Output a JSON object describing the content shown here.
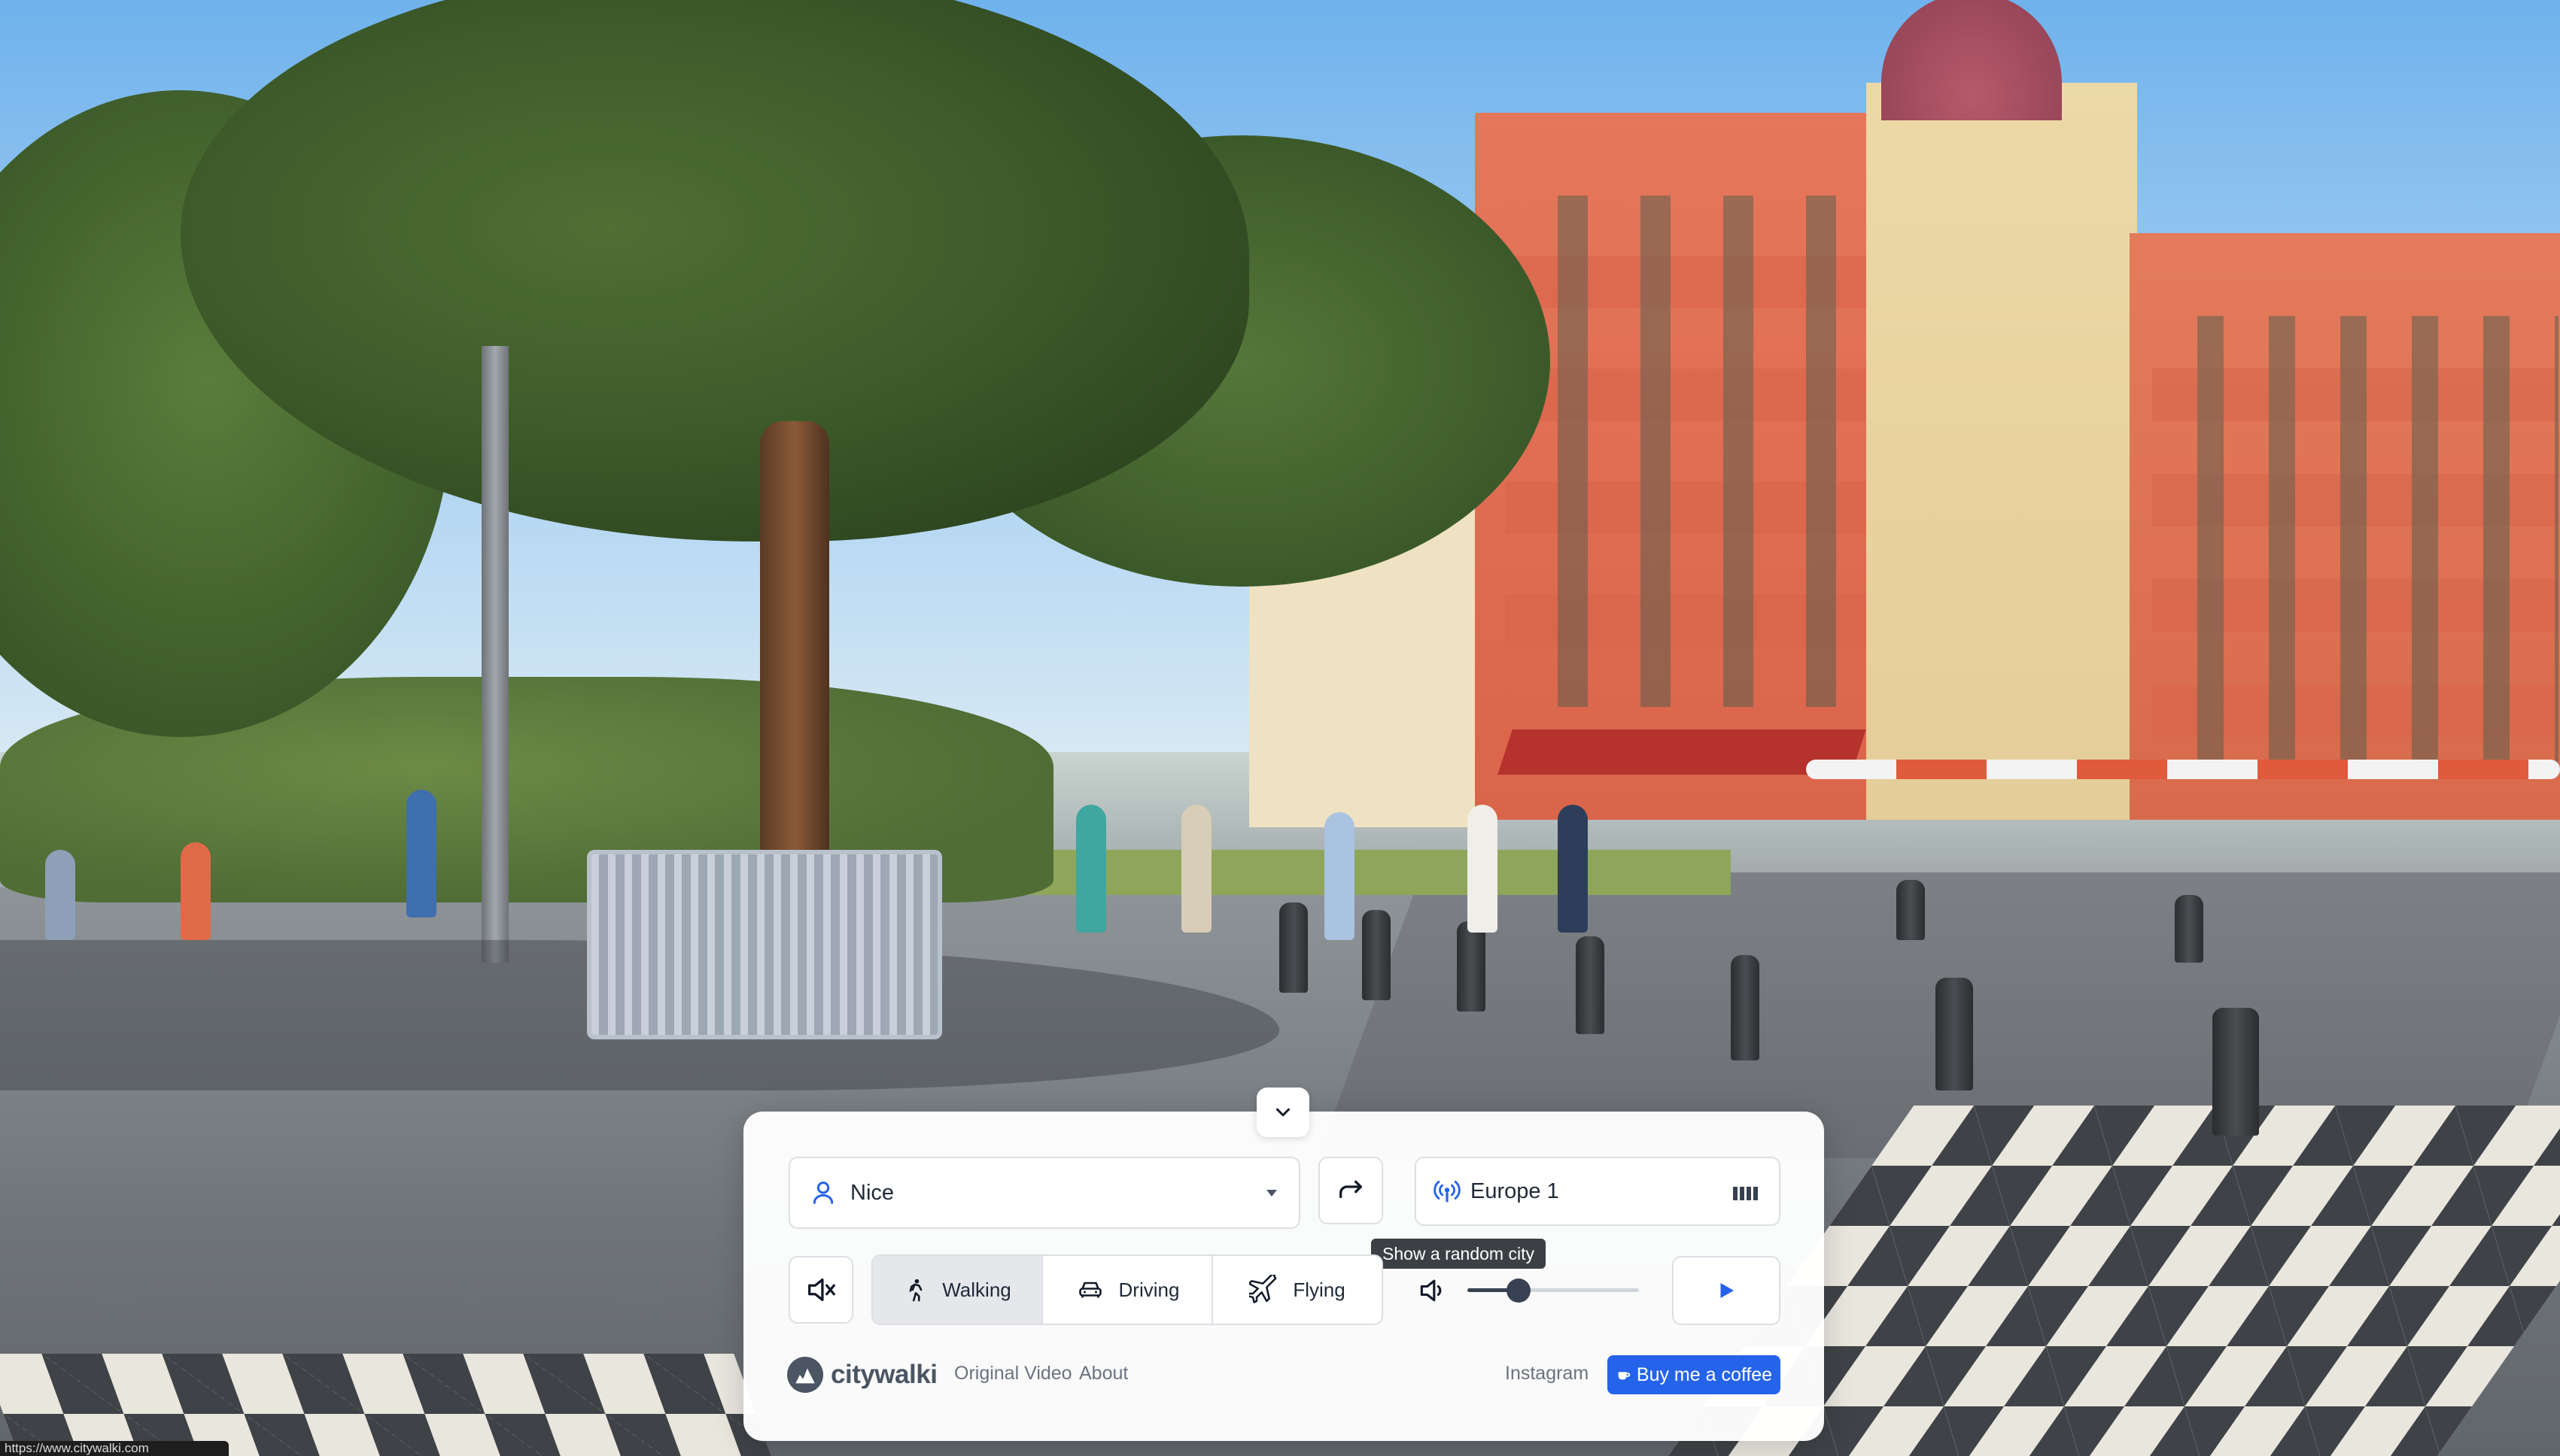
{
  "app": {
    "brand_name": "citywalki"
  },
  "location": {
    "selected_city": "Nice"
  },
  "radio": {
    "station": "Europe 1"
  },
  "tooltip": {
    "text": "Show a random city"
  },
  "travel_modes": [
    {
      "label": "Walking",
      "icon": "walking-person-icon",
      "active": true
    },
    {
      "label": "Driving",
      "icon": "car-icon",
      "active": false
    },
    {
      "label": "Flying",
      "icon": "airplane-icon",
      "active": false
    }
  ],
  "audio": {
    "muted": true,
    "volume_fraction": 0.3
  },
  "footer": {
    "original_video_label": "Original Video",
    "about_label": "About",
    "instagram_label": "Instagram",
    "coffee_label": "Buy me a coffee",
    "coffee_icon": "coffee-cup-icon"
  },
  "status_bar": {
    "url": "https://www.citywalki.com"
  },
  "colors": {
    "accent": "#2563eb",
    "panel_bg": "#ffffff",
    "active_mode_bg": "#e5e7eb"
  }
}
